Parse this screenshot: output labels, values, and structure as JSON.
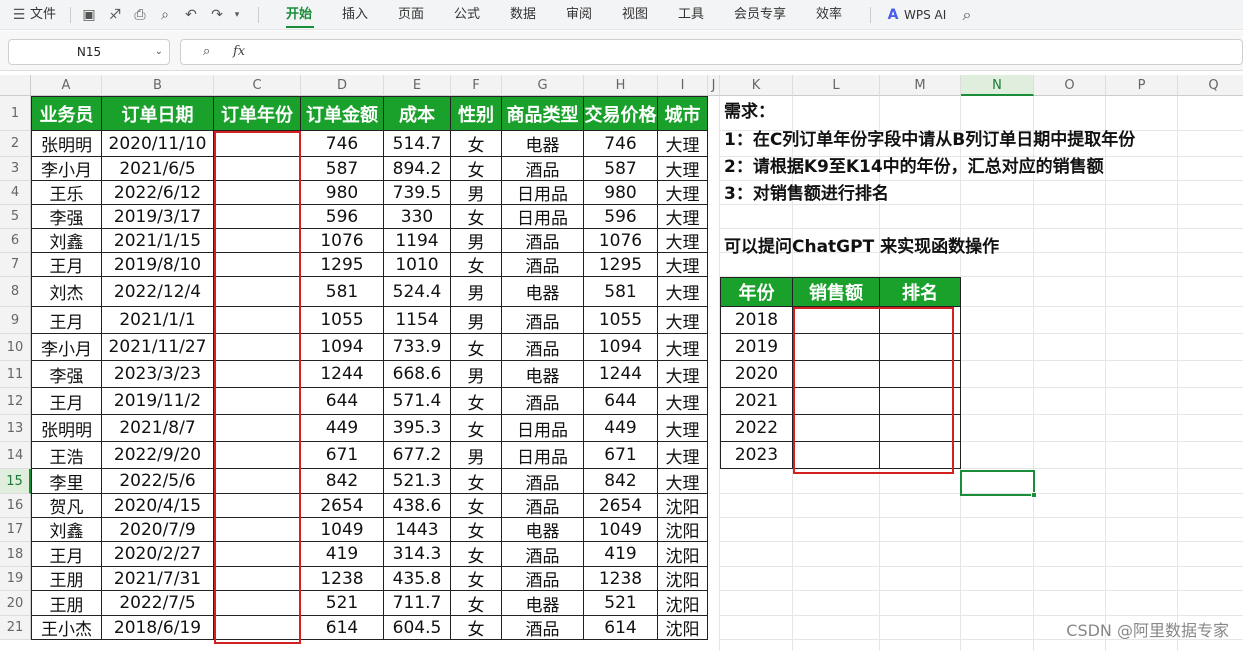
{
  "ribbon": {
    "menu_label": "文件",
    "tabs": [
      "开始",
      "插入",
      "页面",
      "公式",
      "数据",
      "审阅",
      "视图",
      "工具",
      "会员专享",
      "效率"
    ],
    "active_tab": "开始",
    "ai_label": "WPS AI"
  },
  "formula_bar": {
    "cell_ref": "N15",
    "fx_label": "fx",
    "content": ""
  },
  "columns": [
    "A",
    "B",
    "C",
    "D",
    "E",
    "F",
    "G",
    "H",
    "I",
    "J",
    "K",
    "L",
    "M",
    "N",
    "O",
    "P",
    "Q"
  ],
  "selected_column": "N",
  "rows": [
    "1",
    "2",
    "3",
    "4",
    "5",
    "6",
    "7",
    "8",
    "9",
    "10",
    "11",
    "12",
    "13",
    "14",
    "15",
    "16",
    "17",
    "18",
    "19",
    "20",
    "21"
  ],
  "selected_row": "15",
  "table": {
    "headers": [
      "业务员",
      "订单日期",
      "订单年份",
      "订单金额",
      "成本",
      "性别",
      "商品类型",
      "交易价格",
      "城市"
    ],
    "rows": [
      [
        "张明明",
        "2020/11/10",
        "",
        "746",
        "514.7",
        "女",
        "电器",
        "746",
        "大理"
      ],
      [
        "李小月",
        "2021/6/5",
        "",
        "587",
        "894.2",
        "女",
        "酒品",
        "587",
        "大理"
      ],
      [
        "王乐",
        "2022/6/12",
        "",
        "980",
        "739.5",
        "男",
        "日用品",
        "980",
        "大理"
      ],
      [
        "李强",
        "2019/3/17",
        "",
        "596",
        "330",
        "女",
        "日用品",
        "596",
        "大理"
      ],
      [
        "刘鑫",
        "2021/1/15",
        "",
        "1076",
        "1194",
        "男",
        "酒品",
        "1076",
        "大理"
      ],
      [
        "王月",
        "2019/8/10",
        "",
        "1295",
        "1010",
        "女",
        "酒品",
        "1295",
        "大理"
      ],
      [
        "刘杰",
        "2022/12/4",
        "",
        "581",
        "524.4",
        "男",
        "电器",
        "581",
        "大理"
      ],
      [
        "王月",
        "2021/1/1",
        "",
        "1055",
        "1154",
        "男",
        "酒品",
        "1055",
        "大理"
      ],
      [
        "李小月",
        "2021/11/27",
        "",
        "1094",
        "733.9",
        "女",
        "酒品",
        "1094",
        "大理"
      ],
      [
        "李强",
        "2023/3/23",
        "",
        "1244",
        "668.6",
        "男",
        "电器",
        "1244",
        "大理"
      ],
      [
        "王月",
        "2019/11/2",
        "",
        "644",
        "571.4",
        "女",
        "酒品",
        "644",
        "大理"
      ],
      [
        "张明明",
        "2021/8/7",
        "",
        "449",
        "395.3",
        "女",
        "日用品",
        "449",
        "大理"
      ],
      [
        "王浩",
        "2022/9/20",
        "",
        "671",
        "677.2",
        "男",
        "日用品",
        "671",
        "大理"
      ],
      [
        "李里",
        "2022/5/6",
        "",
        "842",
        "521.3",
        "女",
        "酒品",
        "842",
        "大理"
      ],
      [
        "贺凡",
        "2020/4/15",
        "",
        "2654",
        "438.6",
        "女",
        "酒品",
        "2654",
        "沈阳"
      ],
      [
        "刘鑫",
        "2020/7/9",
        "",
        "1049",
        "1443",
        "女",
        "电器",
        "1049",
        "沈阳"
      ],
      [
        "王月",
        "2020/2/27",
        "",
        "419",
        "314.3",
        "女",
        "酒品",
        "419",
        "沈阳"
      ],
      [
        "王朋",
        "2021/7/31",
        "",
        "1238",
        "435.8",
        "女",
        "酒品",
        "1238",
        "沈阳"
      ],
      [
        "王朋",
        "2022/7/5",
        "",
        "521",
        "711.7",
        "女",
        "电器",
        "521",
        "沈阳"
      ],
      [
        "王小杰",
        "2018/6/19",
        "",
        "614",
        "604.5",
        "女",
        "酒品",
        "614",
        "沈阳"
      ]
    ]
  },
  "notes": [
    "需求：",
    "1：在C列订单年份字段中请从B列订单日期中提取年份",
    "2：请根据K9至K14中的年份，汇总对应的销售额",
    "3：对销售额进行排名",
    "可以提问ChatGPT 来实现函数操作"
  ],
  "summary": {
    "headers": [
      "年份",
      "销售额",
      "排名"
    ],
    "years": [
      "2018",
      "2019",
      "2020",
      "2021",
      "2022",
      "2023"
    ]
  },
  "watermark": "CSDN @阿里数据专家",
  "colors": {
    "header_green": "#1aa12b",
    "highlight_red": "#d42020",
    "accent": "#1a8d3b"
  }
}
